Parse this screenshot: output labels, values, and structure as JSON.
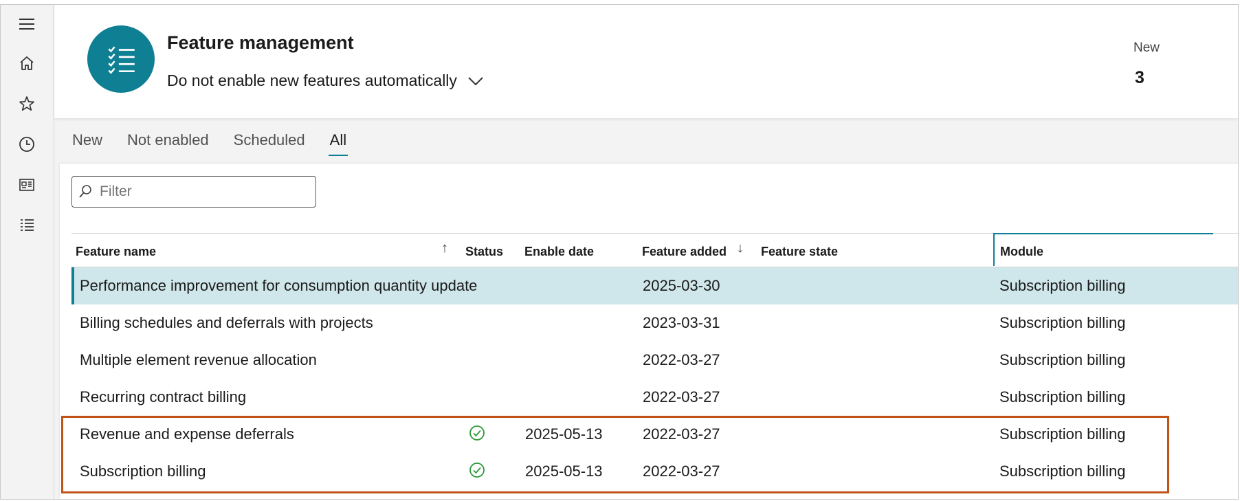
{
  "header": {
    "title": "Feature management",
    "auto_enable_value": "Do not enable new features automatically",
    "new_label": "New",
    "new_count": "3"
  },
  "tabs": [
    {
      "label": "New"
    },
    {
      "label": "Not enabled"
    },
    {
      "label": "Scheduled"
    },
    {
      "label": "All",
      "active": true
    }
  ],
  "filter": {
    "placeholder": "Filter"
  },
  "grid": {
    "columns": {
      "feature_name": "Feature name",
      "status": "Status",
      "enable_date": "Enable date",
      "feature_added": "Feature added",
      "feature_state": "Feature state",
      "module": "Module"
    },
    "rows": [
      {
        "name": "Performance improvement for consumption quantity update",
        "status": "",
        "enable_date": "",
        "added": "2025-03-30",
        "state": "",
        "module": "Subscription billing",
        "selected": true
      },
      {
        "name": "Billing schedules and deferrals with projects",
        "status": "",
        "enable_date": "",
        "added": "2023-03-31",
        "state": "",
        "module": "Subscription billing"
      },
      {
        "name": "Multiple element revenue allocation",
        "status": "",
        "enable_date": "",
        "added": "2022-03-27",
        "state": "",
        "module": "Subscription billing"
      },
      {
        "name": "Recurring contract billing",
        "status": "",
        "enable_date": "",
        "added": "2022-03-27",
        "state": "",
        "module": "Subscription billing"
      },
      {
        "name": "Revenue and expense deferrals",
        "status": "enabled",
        "enable_date": "2025-05-13",
        "added": "2022-03-27",
        "state": "",
        "module": "Subscription billing"
      },
      {
        "name": "Subscription billing",
        "status": "enabled",
        "enable_date": "2025-05-13",
        "added": "2022-03-27",
        "state": "",
        "module": "Subscription billing"
      }
    ]
  },
  "colors": {
    "accent": "#0f7f94",
    "selected_row": "#cfe6ea",
    "enabled_check": "#2e9b3a",
    "highlight_box": "#c0531a"
  },
  "icons": {
    "rail": [
      "hamburger-icon",
      "home-icon",
      "star-icon",
      "clock-icon",
      "workspace-icon",
      "list-icon"
    ],
    "badge": "checklist-icon",
    "status_enabled": "check-circle-icon"
  }
}
